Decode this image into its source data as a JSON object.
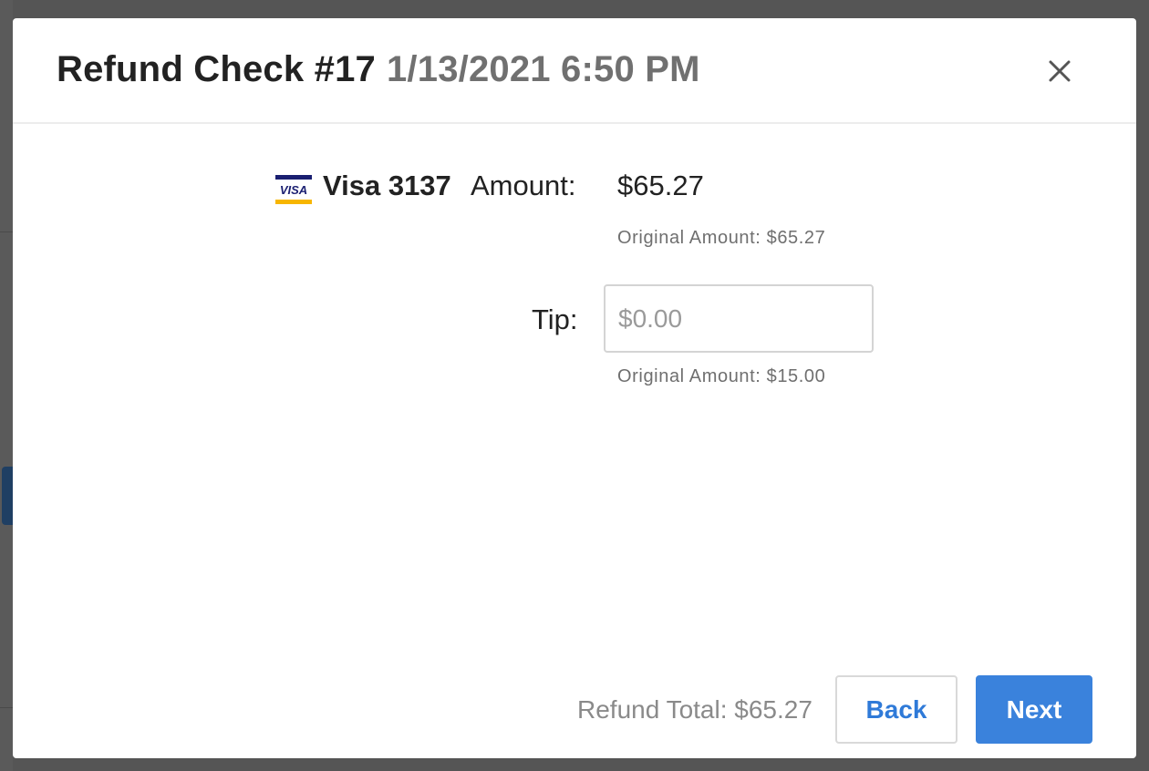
{
  "modal": {
    "title": "Refund Check #17",
    "datetime": "1/13/2021 6:50 PM",
    "close_icon": "close-icon"
  },
  "payment": {
    "card_icon": "visa-card-icon",
    "card_brand_text": "VISA",
    "card_label": "Visa 3137",
    "amount_label": "Amount:",
    "amount_value": "$65.27",
    "original_amount_note": "Original Amount: $65.27",
    "tip_label": "Tip:",
    "tip_placeholder": "$0.00",
    "tip_value": "",
    "original_tip_note": "Original Amount: $15.00"
  },
  "footer": {
    "refund_total": "Refund Total: $65.27",
    "back_label": "Back",
    "next_label": "Next"
  },
  "colors": {
    "overlay": "#555555",
    "primary": "#3a82dc",
    "visa_blue": "#1a1f71",
    "visa_gold": "#f7b600"
  }
}
